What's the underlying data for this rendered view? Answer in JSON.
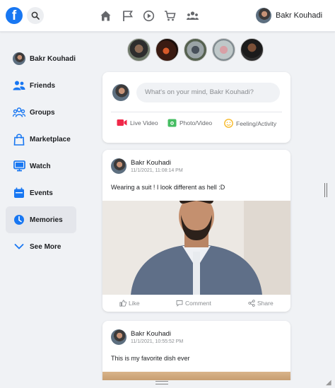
{
  "header": {
    "logo_letter": "f",
    "user_name": "Bakr Kouhadi",
    "nav_icons": [
      "home-icon",
      "flag-icon",
      "watch-icon",
      "marketplace-icon",
      "groups-icon"
    ]
  },
  "sidebar": {
    "items": [
      {
        "label": "Bakr Kouhadi",
        "icon": "avatar"
      },
      {
        "label": "Friends",
        "icon": "friends-icon"
      },
      {
        "label": "Groups",
        "icon": "groups-icon"
      },
      {
        "label": "Marketplace",
        "icon": "marketplace-icon"
      },
      {
        "label": "Watch",
        "icon": "watch-icon"
      },
      {
        "label": "Events",
        "icon": "events-icon"
      },
      {
        "label": "Memories",
        "icon": "memories-icon"
      },
      {
        "label": "See More",
        "icon": "chevron-down-icon"
      }
    ],
    "active_item": "Memories"
  },
  "composer": {
    "placeholder": "What's on your mind, Bakr Kouhadi?",
    "live_label": "Live Video",
    "photo_label": "Photo/Video",
    "feeling_label": "Feeling/Activity"
  },
  "posts": [
    {
      "author": "Bakr Kouhadi",
      "time": "11/1/2021, 11:08:14 PM",
      "text": "Wearing a suit ! I look different as hell :D",
      "like_label": "Like",
      "comment_label": "Comment",
      "share_label": "Share"
    },
    {
      "author": "Bakr Kouhadi",
      "time": "11/1/2021, 10:55:52 PM",
      "text": "This is my favorite dish ever"
    }
  ],
  "colors": {
    "brand": "#1877f2",
    "live": "#f02849",
    "photo": "#45bd62",
    "feeling": "#f7b928"
  }
}
